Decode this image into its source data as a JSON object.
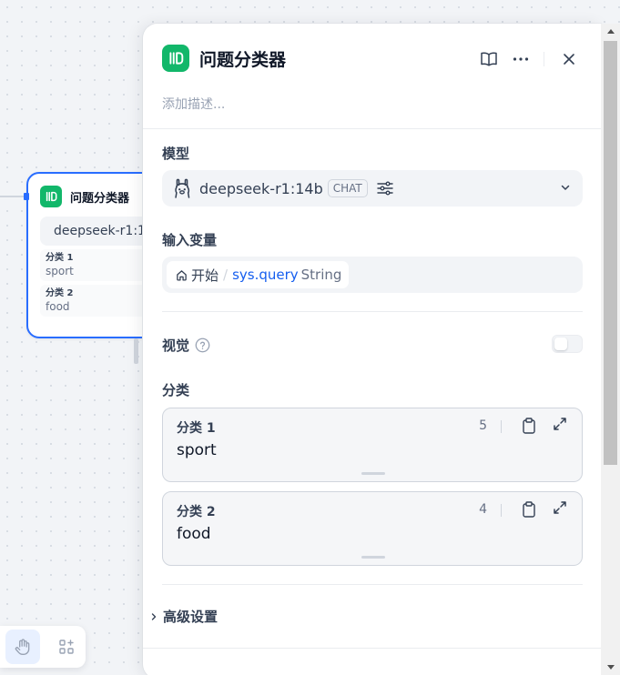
{
  "node": {
    "title": "问题分类器",
    "model_name": "deepseek-r1:14b",
    "classes": [
      {
        "label": "分类 1",
        "value": "sport"
      },
      {
        "label": "分类 2",
        "value": "food"
      }
    ]
  },
  "panel": {
    "title": "问题分类器",
    "description_placeholder": "添加描述...",
    "model_section": {
      "label": "模型",
      "model_name": "deepseek-r1:14b",
      "mode_badge": "CHAT"
    },
    "input_section": {
      "label": "输入变量",
      "source_node": "开始",
      "separator": "/",
      "variable": "sys.query",
      "type": "String"
    },
    "vision": {
      "label": "视觉",
      "enabled": false
    },
    "classes_section": {
      "label": "分类",
      "items": [
        {
          "label": "分类 1",
          "value": "sport",
          "count": "5"
        },
        {
          "label": "分类 2",
          "value": "food",
          "count": "4"
        }
      ]
    },
    "advanced_label": "高级设置"
  },
  "icons": {
    "node_type": "question-classifier-icon",
    "model_avatar": "ollama-llama-icon",
    "header_actions": [
      "book-icon",
      "more-horizontal-icon",
      "close-icon"
    ],
    "toolbar": [
      "hand-icon",
      "add-block-icon"
    ]
  },
  "colors": {
    "node_icon_bg": "#12b76a",
    "selection_border": "#296dff",
    "variable_text": "#155eef"
  }
}
